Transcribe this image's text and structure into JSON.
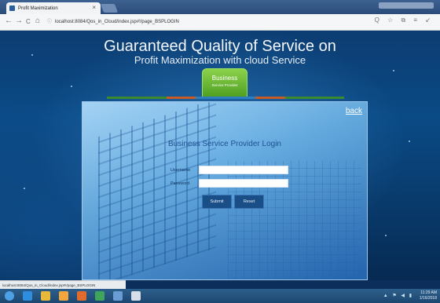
{
  "browser": {
    "tab_title": "Profit Maximization",
    "tab_close": "×",
    "url": "localhost:8084/Qos_in_Cloud/index.jsp#!/page_BSPLOGIN",
    "url_info_icon": "ⓘ",
    "nav": {
      "back": "←",
      "forward": "→",
      "reload": "C",
      "home": "⌂"
    },
    "right_icons": "Q ☆ ⧉ ≡ ↙"
  },
  "header": {
    "title_line1": "Guaranteed Quality of Service on",
    "title_line2": "Profit Maximization with cloud Service"
  },
  "menu": {
    "label": "Business",
    "sublabel": "Service Provider"
  },
  "stripe_colors": [
    "#3b8a2e",
    "#3b8a2e",
    "#c65b26",
    "#2d7fbf",
    "#2d7fbf",
    "#c65b26",
    "#3b8a2e",
    "#3b8a2e"
  ],
  "login": {
    "back_label": "back",
    "title": "Business Service Provider Login",
    "username_label": "Username",
    "password_label": "Password",
    "username_value": "",
    "password_value": "",
    "submit_label": "Submit",
    "reset_label": "Reset"
  },
  "status_bar": {
    "url": "localhost:8084/Qos_in_Cloud/index.jsp#!/page_BSPLOGIN"
  },
  "taskbar": {
    "icons": [
      "start-icon",
      "ie-icon",
      "explorer-icon",
      "media-icon",
      "firefox-icon",
      "chrome-icon",
      "netbeans-icon",
      "app-icon"
    ],
    "icon_colors": [
      "#4ea0e6",
      "#2f8de0",
      "#e8b83a",
      "#f3a63b",
      "#e06b2c",
      "#3fa55a",
      "#6a9cd6",
      "#d8dfe8"
    ],
    "tray": "▲ ⚑ ◀ ▮",
    "time": "11:29 AM",
    "date": "1/16/2018"
  }
}
